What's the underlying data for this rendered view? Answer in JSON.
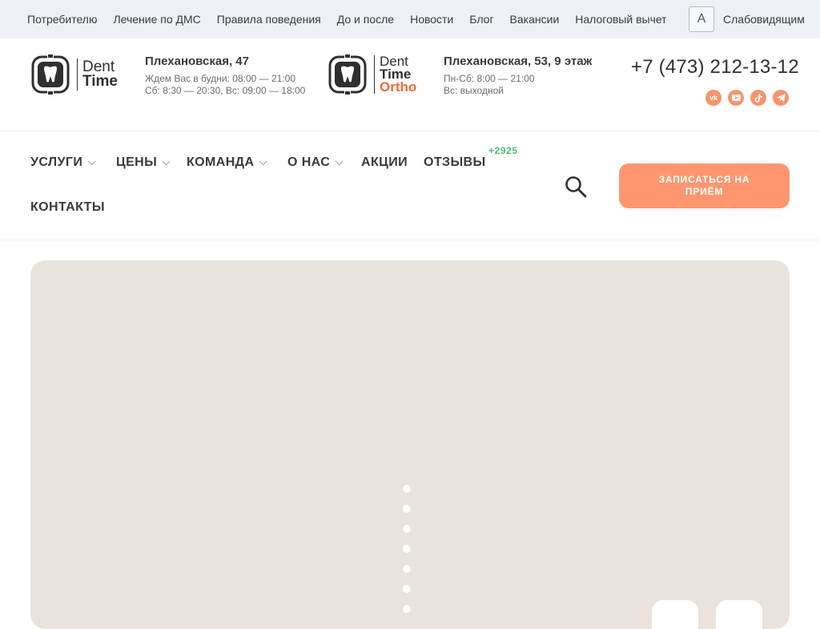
{
  "topbar": {
    "links": [
      "Потребителю",
      "Лечение по ДМС",
      "Правила поведения",
      "До и после",
      "Новости",
      "Блог",
      "Вакансии",
      "Налоговый вычет"
    ],
    "a11y_glyph": "A",
    "a11y_label": "Слабовидящим"
  },
  "clinic1": {
    "logo_line1": "Dent",
    "logo_line2": "Time",
    "street": "Плехановская, 47",
    "hours1": "Ждем Вас в будни: 08:00 — 21:00",
    "hours2": "Сб: 8:30 — 20:30, Вс: 09:00 — 18:00"
  },
  "clinic2": {
    "logo_line1": "Dent",
    "logo_line2": "Time",
    "logo_line3": "Ortho",
    "street": "Плехановская, 53, 9 этаж",
    "hours1": "Пн-Сб: 8:00 — 21:00",
    "hours2": "Вс: выходной"
  },
  "contact": {
    "phone": "+7 (473) 212-13-12",
    "socials": [
      "vk-icon",
      "youtube-icon",
      "tiktok-icon",
      "telegram-icon"
    ],
    "social_color": "#f8946c"
  },
  "nav": {
    "services": "УСЛУГИ",
    "prices": "ЦЕНЫ",
    "team": "КОМАНДА",
    "about": "О НАС",
    "promos": "АКЦИИ",
    "reviews": "ОТЗЫВЫ",
    "reviews_badge": "+2925",
    "contacts": "КОНТАКТЫ",
    "cta_label": "ЗАПИСАТЬСЯ НА ПРИЁМ"
  },
  "colors": {
    "accent": "#ff9670",
    "brand_orange": "#ef6a3a",
    "badge_green": "#4dbb75",
    "hero_bg": "#e8e3dd"
  }
}
